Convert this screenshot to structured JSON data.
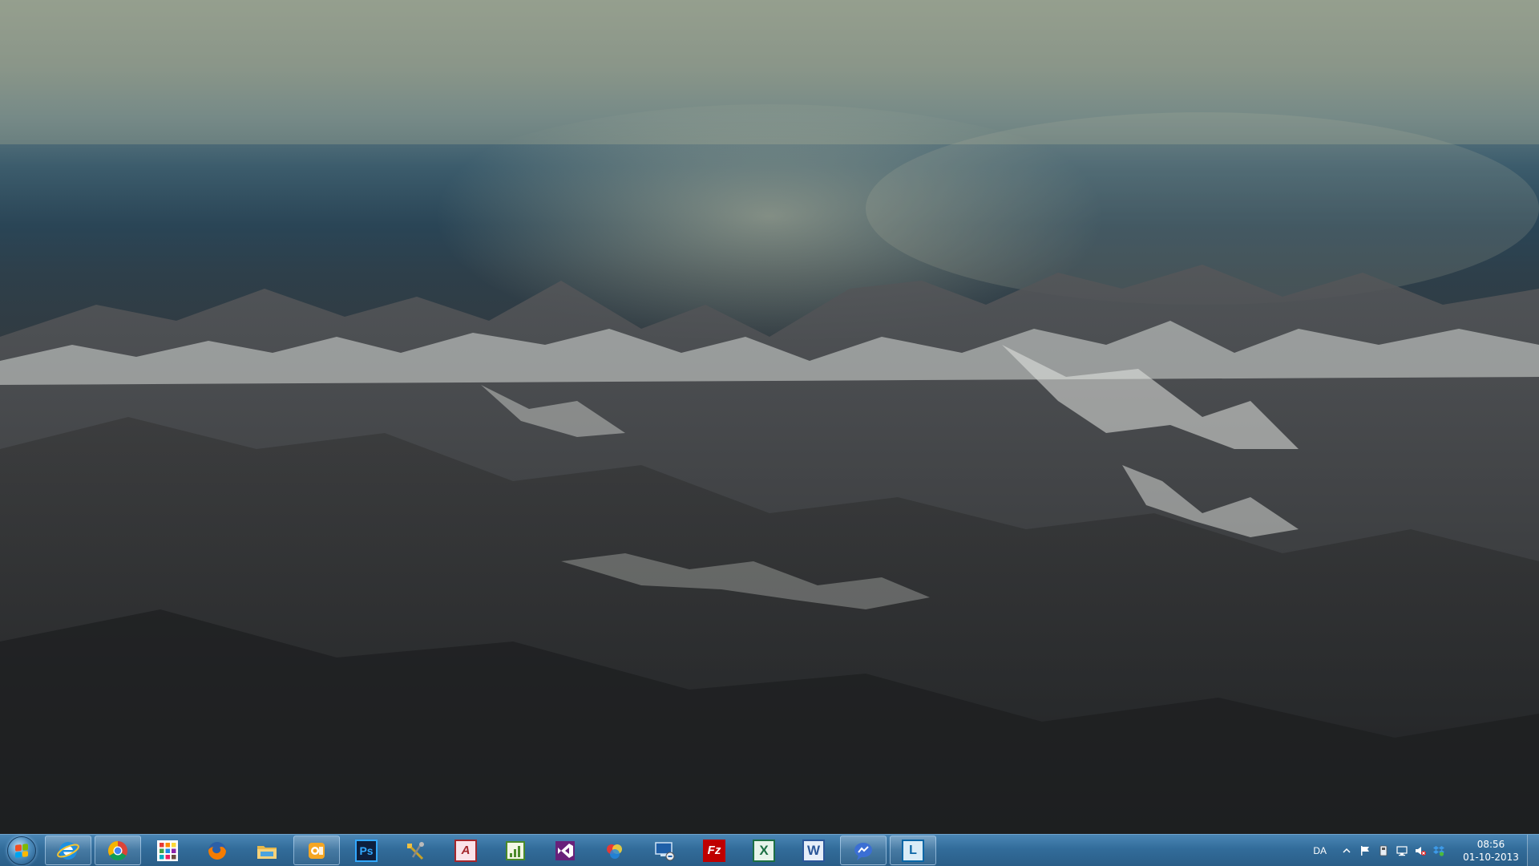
{
  "taskbar": {
    "pinned_apps": [
      {
        "name": "Internet Explorer",
        "icon": "internet-explorer-icon",
        "running": true
      },
      {
        "name": "Google Chrome",
        "icon": "chrome-icon",
        "running": true
      },
      {
        "name": "Apps",
        "icon": "apps-grid-icon",
        "running": false
      },
      {
        "name": "Firefox",
        "icon": "firefox-icon",
        "running": false
      },
      {
        "name": "Windows Explorer",
        "icon": "file-explorer-icon",
        "running": false
      },
      {
        "name": "Outlook",
        "icon": "outlook-icon",
        "running": true
      },
      {
        "name": "Photoshop",
        "icon": "photoshop-icon",
        "running": false
      },
      {
        "name": "Tools",
        "icon": "tools-icon",
        "running": false
      },
      {
        "name": "Access",
        "icon": "access-icon",
        "running": false
      },
      {
        "name": "Project",
        "icon": "project-icon",
        "running": false
      },
      {
        "name": "Visual Studio",
        "icon": "visual-studio-icon",
        "running": false
      },
      {
        "name": "Paint Tool",
        "icon": "paint-tool-icon",
        "running": false
      },
      {
        "name": "Remote Desktop",
        "icon": "remote-desktop-icon",
        "running": false
      },
      {
        "name": "FileZilla",
        "icon": "filezilla-icon",
        "running": false
      },
      {
        "name": "Excel",
        "icon": "excel-icon",
        "running": false
      },
      {
        "name": "Word",
        "icon": "word-icon",
        "running": false
      },
      {
        "name": "Messenger",
        "icon": "messenger-icon",
        "running": true
      },
      {
        "name": "Lync",
        "icon": "lync-icon",
        "running": true
      }
    ],
    "icon_text": {
      "photoshop": "Ps",
      "filezilla": "Fz",
      "excel": "X",
      "word": "W",
      "access": "A",
      "lync": "L"
    },
    "tray": {
      "language": "DA",
      "icons": [
        "show-hidden-icons-chevron-icon",
        "action-center-flag-icon",
        "usb-device-icon",
        "network-icon",
        "volume-muted-icon",
        "dropbox-icon"
      ]
    },
    "clock": {
      "time": "08:56",
      "date": "01-10-2013"
    }
  },
  "colors": {
    "taskbar_top": "#4a86b5",
    "taskbar_bottom": "#2a5e88",
    "start_flag": [
      "#f25022",
      "#7fba00",
      "#00a4ef",
      "#ffb900"
    ]
  }
}
